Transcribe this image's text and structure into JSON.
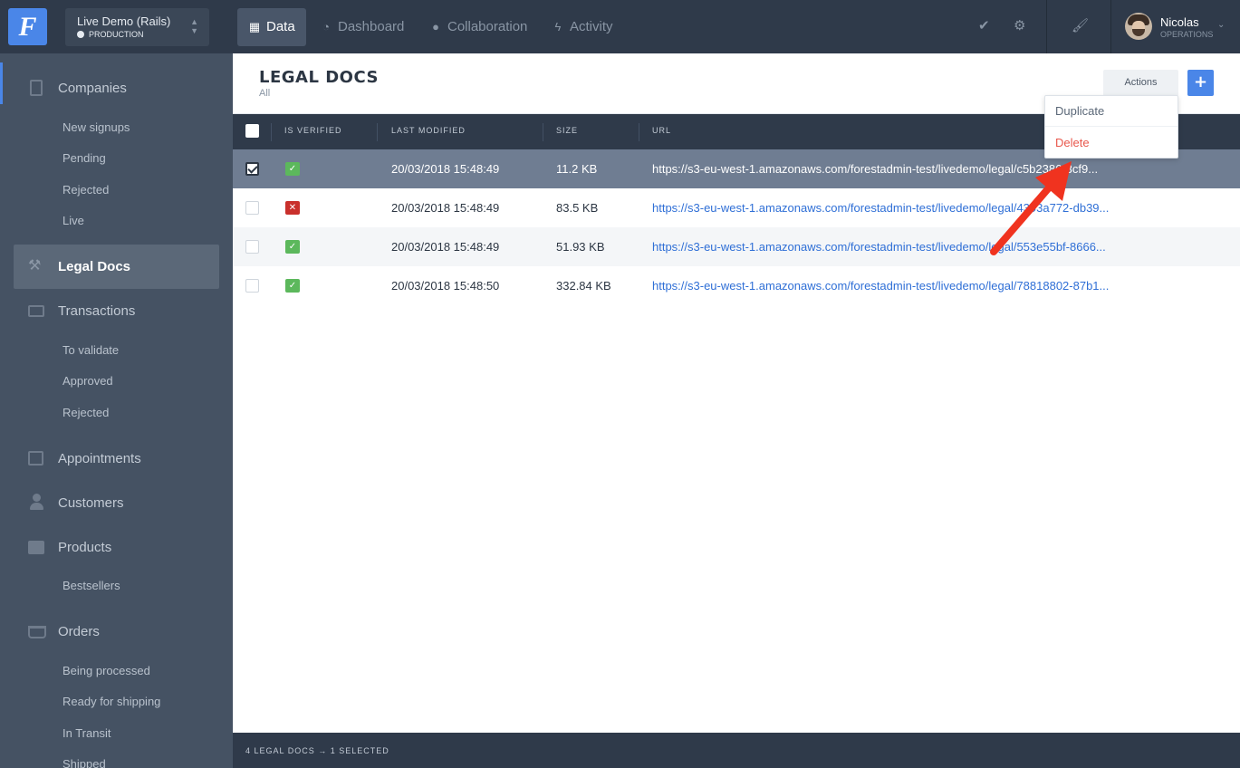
{
  "app": {
    "logo_letter": "F",
    "project_name": "Live Demo (Rails)",
    "environment": "PRODUCTION"
  },
  "nav": {
    "tabs": [
      {
        "label": "Data",
        "icon": "grid-icon",
        "active": true
      },
      {
        "label": "Dashboard",
        "icon": "gauge-icon",
        "active": false
      },
      {
        "label": "Collaboration",
        "icon": "chat-icon",
        "active": false
      },
      {
        "label": "Activity",
        "icon": "bolt-icon",
        "active": false
      }
    ]
  },
  "user": {
    "name": "Nicolas",
    "role": "OPERATIONS"
  },
  "sidebar": {
    "sections": [
      {
        "label": "Companies",
        "icon": "building-icon",
        "items": [
          "New signups",
          "Pending",
          "Rejected",
          "Live"
        ]
      },
      {
        "label": "Legal Docs",
        "icon": "gavel-icon",
        "active": true,
        "items": []
      },
      {
        "label": "Transactions",
        "icon": "money-icon",
        "items": [
          "To validate",
          "Approved",
          "Rejected"
        ]
      },
      {
        "label": "Appointments",
        "icon": "calendar-icon",
        "items": []
      },
      {
        "label": "Customers",
        "icon": "user-icon",
        "items": []
      },
      {
        "label": "Products",
        "icon": "archive-icon",
        "items": [
          "Bestsellers"
        ]
      },
      {
        "label": "Orders",
        "icon": "basket-icon",
        "items": [
          "Being processed",
          "Ready for shipping",
          "In Transit",
          "Shipped"
        ]
      }
    ]
  },
  "header": {
    "title": "LEGAL DOCS",
    "subtitle": "All",
    "actions_label": "Actions",
    "add_label": "+"
  },
  "table": {
    "columns": [
      "IS VERIFIED",
      "LAST MODIFIED",
      "SIZE",
      "URL"
    ],
    "rows": [
      {
        "selected": true,
        "verified": true,
        "last_modified": "20/03/2018 15:48:49",
        "size": "11.2 KB",
        "url": "https://s3-eu-west-1.amazonaws.com/forestadmin-test/livedemo/legal/c5b2386-3cf9..."
      },
      {
        "selected": false,
        "verified": false,
        "last_modified": "20/03/2018 15:48:49",
        "size": "83.5 KB",
        "url": "https://s3-eu-west-1.amazonaws.com/forestadmin-test/livedemo/legal/4393a772-db39..."
      },
      {
        "selected": false,
        "verified": true,
        "last_modified": "20/03/2018 15:48:49",
        "size": "51.93 KB",
        "url": "https://s3-eu-west-1.amazonaws.com/forestadmin-test/livedemo/legal/553e55bf-8666..."
      },
      {
        "selected": false,
        "verified": true,
        "last_modified": "20/03/2018 15:48:50",
        "size": "332.84 KB",
        "url": "https://s3-eu-west-1.amazonaws.com/forestadmin-test/livedemo/legal/78818802-87b1..."
      }
    ]
  },
  "actions_menu": {
    "items": [
      "Duplicate",
      "Delete"
    ]
  },
  "footer": {
    "summary": "4 LEGAL DOCS → 1 SELECTED"
  },
  "colors": {
    "accent": "#4a86e8",
    "topbar": "#2f3a4a",
    "sidebar": "#455263",
    "delete": "#e8574c",
    "verified": "#5cb85c",
    "unverified": "#c9302c",
    "annotation_arrow": "#f0331f"
  }
}
